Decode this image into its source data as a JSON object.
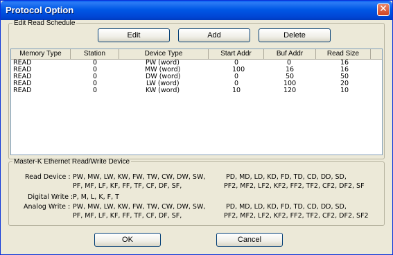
{
  "window": {
    "title": "Protocol Option",
    "close_glyph": "✕"
  },
  "edit_group": {
    "legend": "Edit Read Schedule",
    "buttons": {
      "edit": "Edit",
      "add": "Add",
      "delete": "Delete"
    }
  },
  "table": {
    "columns": [
      "Memory Type",
      "Station",
      "Device Type",
      "Start Addr",
      "Buf Addr",
      "Read Size"
    ],
    "rows": [
      [
        "READ",
        "0",
        "PW (word)",
        "0",
        "0",
        "16"
      ],
      [
        "READ",
        "0",
        "MW (word)",
        "100",
        "16",
        "16"
      ],
      [
        "READ",
        "0",
        "DW (word)",
        "0",
        "50",
        "50"
      ],
      [
        "READ",
        "0",
        "LW (word)",
        "0",
        "100",
        "20"
      ],
      [
        "READ",
        "0",
        "KW (word)",
        "10",
        "120",
        "10"
      ]
    ]
  },
  "device_group": {
    "legend": "Master-K Ethernet Read/Write Device",
    "read_device_label": "Read Device :",
    "read_device_line1a": "PW,  MW,  LW,  KW,  FW,  TW,  CW,  DW,  SW,",
    "read_device_line1b": "PD,  MD,  LD,  KD,  FD,  TD,  CD,  DD,  SD,",
    "read_device_line2a": "PF,   MF,   LF,   KF,   FF,   TF,   CF,   DF,   SF,",
    "read_device_line2b": "PF2,  MF2,  LF2,  KF2,  FF2,  TF2,  CF2,  DF2,  SF",
    "digital_write_label": "Digital Write :",
    "digital_write_value": "P,  M,  L,  K,  F,  T",
    "analog_write_label": "Analog Write :",
    "analog_write_line1a": "PW,  MW,  LW,  KW,  FW,  TW,  CW,  DW,  SW,",
    "analog_write_line1b": "PD,  MD,  LD,  KD,  FD,  TD,  CD,  DD,  SD,",
    "analog_write_line2a": "PF,   MF,   LF,   KF,   FF,   TF,   CF,   DF,   SF,",
    "analog_write_line2b": "PF2,  MF2,  LF2,  KF2,  FF2,  TF2,  CF2,  DF2,  SF2"
  },
  "footer": {
    "ok": "OK",
    "cancel": "Cancel"
  }
}
